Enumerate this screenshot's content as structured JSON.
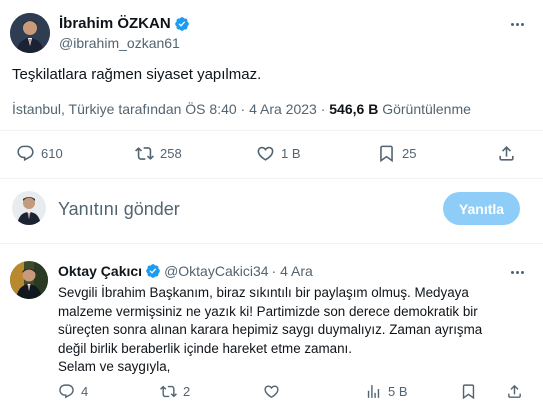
{
  "tweet": {
    "author_name": "İbrahim ÖZKAN",
    "author_handle": "@ibrahim_ozkan61",
    "text": "Teşkilatlara rağmen siyaset yapılmaz.",
    "meta_location_time": "İstanbul, Türkiye tarafından ÖS 8:40 · 4 Ara 2023 · ",
    "meta_views": "546,6 B",
    "meta_views_label": " Görüntülenme",
    "replies": "610",
    "retweets": "258",
    "likes": "1 B",
    "bookmarks": "25"
  },
  "reply_box": {
    "placeholder": "Yanıtını gönder",
    "button_label": "Yanıtla"
  },
  "reply": {
    "author_name": "Oktay Çakıcı",
    "author_handle": "@OktayCakici34",
    "time": "· 4 Ara",
    "lines": [
      "Sevgili İbrahim Başkanım, biraz sıkıntılı bir paylaşım olmuş. Medyaya",
      "malzeme vermişsiniz ne yazık ki! Partimizde son derece demokratik bir",
      "süreçten sonra alınan karara hepimiz saygı duymalıyız. Zaman ayrışma",
      "değil birlik beraberlik içinde hareket etme zamanı.",
      "Selam ve saygıyla,"
    ],
    "replies": "4",
    "retweets": "2",
    "likes": "",
    "views": "5 B"
  },
  "colors": {
    "text": "#0f1419",
    "secondary": "#536471",
    "verified": "#1d9bf0",
    "button_disabled": "#8ecdf8",
    "divider": "#eff3f4"
  },
  "icons": [
    "verified-badge-icon",
    "more-icon",
    "reply-icon",
    "retweet-icon",
    "like-icon",
    "bookmark-icon",
    "share-icon",
    "views-icon"
  ]
}
